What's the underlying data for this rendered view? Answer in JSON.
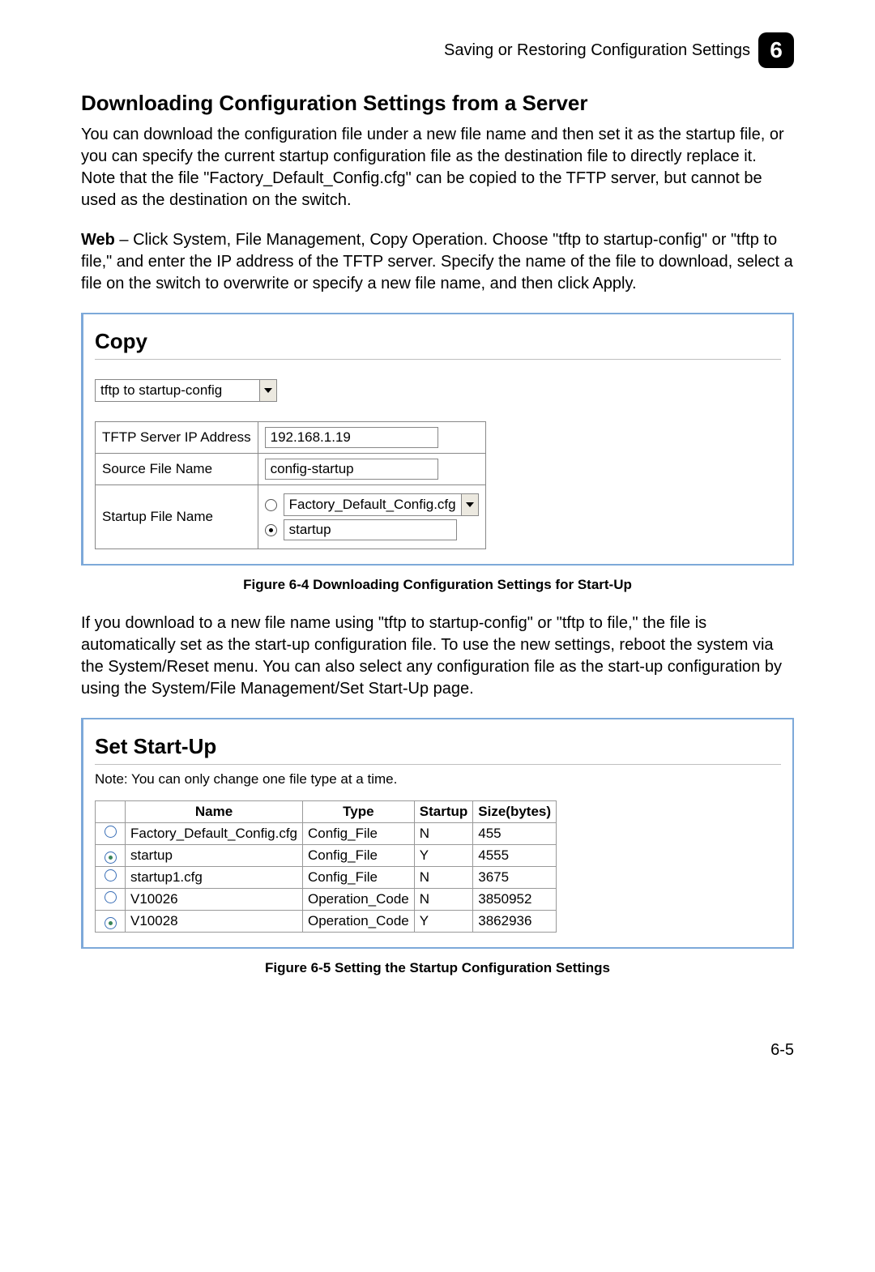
{
  "header": {
    "running_title": "Saving or Restoring Configuration Settings",
    "chapter_number": "6"
  },
  "section": {
    "title": "Downloading Configuration Settings from a Server",
    "intro_para": "You can download the configuration file under a new file name and then set it as the startup file, or you can specify the current startup configuration file as the destination file to directly replace it. Note that the file \"Factory_Default_Config.cfg\" can be copied to the TFTP server, but cannot be used as the destination on the switch.",
    "web_para_lead": "Web",
    "web_para": " – Click System, File Management, Copy Operation. Choose \"tftp to startup-config\" or \"tftp to file,\" and enter the IP address of the TFTP server. Specify the name of the file to download, select a file on the switch to overwrite or specify a new file name, and then click Apply."
  },
  "figure1": {
    "panel_title": "Copy",
    "select_value": "tftp to startup-config",
    "rows": {
      "tftp_label": "TFTP Server IP Address",
      "tftp_value": "192.168.1.19",
      "source_label": "Source File Name",
      "source_value": "config-startup",
      "startup_label": "Startup File Name",
      "startup_option_dropdown": "Factory_Default_Config.cfg",
      "startup_option_text_value": "startup"
    },
    "caption": "Figure 6-4  Downloading Configuration Settings for Start-Up"
  },
  "mid_para": "If you download to a new file name using \"tftp to startup-config\" or \"tftp to file,\" the file is automatically set as the start-up configuration file. To use the new settings, reboot the system via the System/Reset menu. You can also select any configuration file as the start-up configuration by using the System/File Management/Set Start-Up page.",
  "figure2": {
    "panel_title": "Set Start-Up",
    "note": "Note: You can only change one file type at a time.",
    "columns": [
      "",
      "Name",
      "Type",
      "Startup",
      "Size(bytes)"
    ],
    "rows": [
      {
        "selected": false,
        "name": "Factory_Default_Config.cfg",
        "type": "Config_File",
        "startup": "N",
        "size": "455"
      },
      {
        "selected": true,
        "name": "startup",
        "type": "Config_File",
        "startup": "Y",
        "size": "4555"
      },
      {
        "selected": false,
        "name": "startup1.cfg",
        "type": "Config_File",
        "startup": "N",
        "size": "3675"
      },
      {
        "selected": false,
        "name": "V10026",
        "type": "Operation_Code",
        "startup": "N",
        "size": "3850952"
      },
      {
        "selected": true,
        "name": "V10028",
        "type": "Operation_Code",
        "startup": "Y",
        "size": "3862936"
      }
    ],
    "caption": "Figure 6-5  Setting the Startup Configuration Settings"
  },
  "page_number": "6-5"
}
